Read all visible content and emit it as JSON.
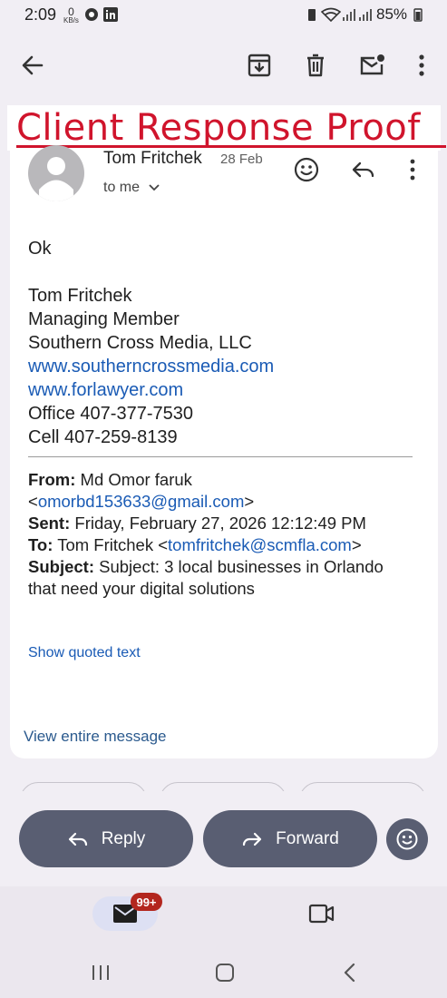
{
  "status_bar": {
    "time": "2:09",
    "net_speed_value": "0",
    "net_speed_unit": "KB/s",
    "battery": "85%"
  },
  "toolbar": {
    "back_icon": "arrow-left-icon",
    "archive_icon": "archive-icon",
    "delete_icon": "trash-icon",
    "mark_unread_icon": "mark-unread-icon",
    "more_icon": "more-vert-icon"
  },
  "banner": {
    "text": "Client Response Proof",
    "color": "#d0142c"
  },
  "message": {
    "sender_name": "Tom Fritchek",
    "date": "28 Feb",
    "recipient_line": "to me",
    "body_greeting": "Ok",
    "signature": {
      "name": "Tom Fritchek",
      "title": "Managing Member",
      "company": "Southern Cross Media, LLC",
      "website1": "www.southerncrossmedia.com",
      "website2": "www.forlawyer.com",
      "office": "Office 407-377-7530",
      "cell": "Cell 407-259-8139"
    },
    "quoted_header": {
      "from_label": "From:",
      "from_name": " Md Omor faruk",
      "from_email_open": "<",
      "from_email": "omorbd153633@gmail.com",
      "from_email_close": ">",
      "sent_label": "Sent:",
      "sent_value": " Friday, February 27, 2026 12:12:49 PM",
      "to_label": "To:",
      "to_name": " Tom Fritchek <",
      "to_email": "tomfritchek@scmfla.com",
      "to_close": ">",
      "subject_label": "Subject:",
      "subject_line1": " Subject: 3 local businesses in Orlando",
      "subject_line2": "that need your digital solutions"
    },
    "show_quoted_text": "Show quoted text",
    "view_entire_message": "View entire message"
  },
  "actions": {
    "reply_label": "Reply",
    "forward_label": "Forward"
  },
  "bottom_nav": {
    "mail_badge": "99+"
  },
  "colors": {
    "accent_link": "#1a5bb5",
    "action_pill": "#595e72",
    "badge": "#b3261e"
  }
}
